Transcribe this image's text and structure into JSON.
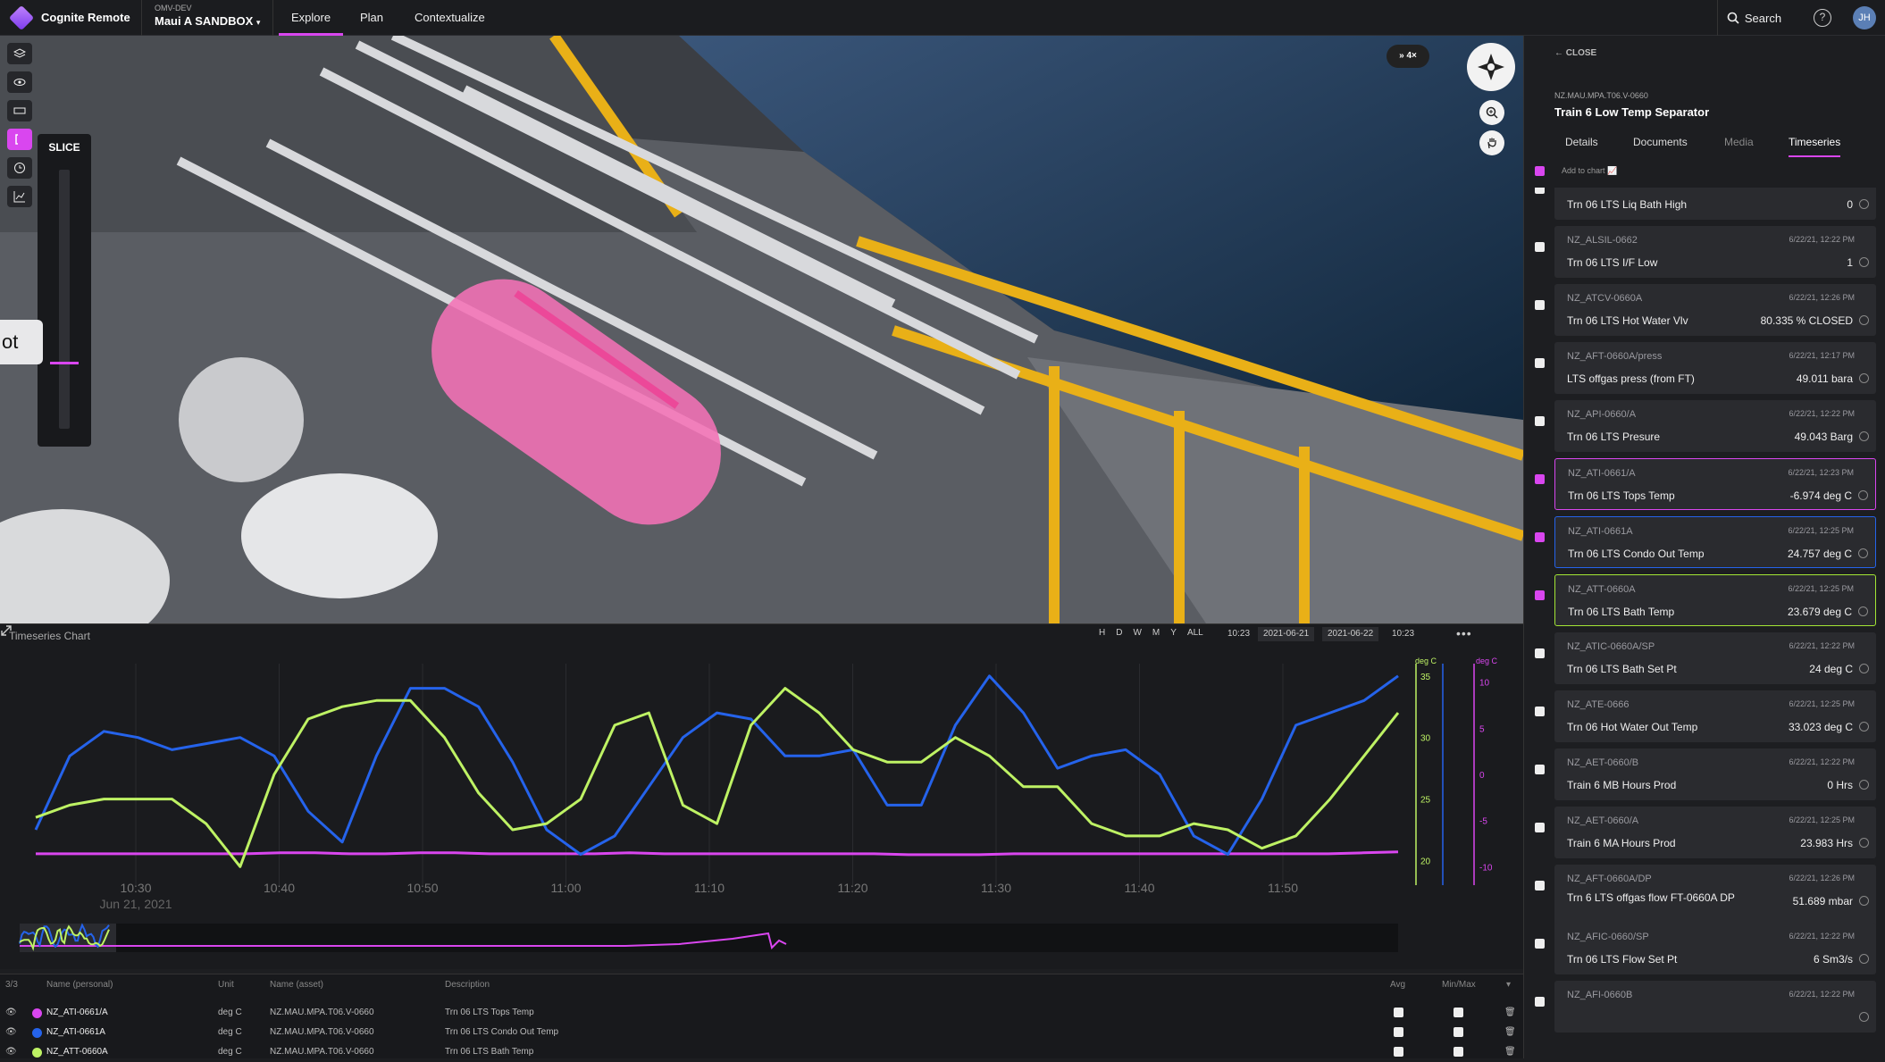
{
  "topbar": {
    "app_name": "Cognite Remote",
    "project_sub": "OMV-DEV",
    "project_name": "Maui A SANDBOX",
    "tabs": [
      "Explore",
      "Plan",
      "Contextualize"
    ],
    "search": "Search",
    "help": "?",
    "avatar": "JH"
  },
  "scene": {
    "slice_label": "SLICE",
    "overlay_text": "ot",
    "speed_label": "» 4×",
    "colors": {
      "highlight": "#f472b6",
      "accent": "#d946ef"
    }
  },
  "chart": {
    "title": "Timeseries Chart",
    "ranges": [
      "H",
      "D",
      "W",
      "M",
      "Y",
      "ALL"
    ],
    "from_time": "10:23",
    "from_date": "2021-06-21",
    "to_date": "2021-06-22",
    "to_time": "10:23",
    "more": "•••",
    "y_axes": [
      {
        "label": "deg C",
        "ticks": [
          "35",
          "30",
          "25",
          "20"
        ]
      },
      {
        "label": "deg C",
        "ticks": [
          "10",
          "5",
          "0",
          "-5",
          "-10"
        ]
      }
    ]
  },
  "chart_data": {
    "type": "line",
    "x_ticks": [
      "10:30",
      "10:40",
      "10:50",
      "11:00",
      "11:10",
      "11:20",
      "11:30",
      "11:40",
      "11:50"
    ],
    "x_date": "Jun 21, 2021",
    "series": [
      {
        "name": "NZ_ATI-0661/A",
        "color": "#d946ef",
        "axis": "right2",
        "values": [
          -8.6,
          -8.6,
          -8.6,
          -8.6,
          -8.6,
          -8.6,
          -8.6,
          -8.5,
          -8.5,
          -8.6,
          -8.6,
          -8.5,
          -8.5,
          -8.6,
          -8.6,
          -8.6,
          -8.6,
          -8.5,
          -8.6,
          -8.6,
          -8.6,
          -8.6,
          -8.6,
          -8.6,
          -8.6,
          -8.7,
          -8.7,
          -8.7,
          -8.6,
          -8.6,
          -8.6,
          -8.6,
          -8.6,
          -8.6,
          -8.6,
          -8.6,
          -8.6,
          -8.6,
          -8.5,
          -8.4
        ]
      },
      {
        "name": "NZ_ATI-0661A",
        "color": "#2563eb",
        "axis": "right1",
        "values": [
          22.5,
          28.5,
          30.5,
          30,
          29,
          29.5,
          30,
          28.5,
          24,
          21.5,
          28.5,
          34,
          34,
          32.5,
          28,
          22.5,
          20.5,
          22,
          26,
          30,
          32,
          31.5,
          28.5,
          28.5,
          29,
          24.5,
          24.5,
          31,
          35,
          32,
          27.5,
          28.5,
          29,
          27,
          22,
          20.5,
          25,
          31,
          32,
          33,
          35
        ]
      },
      {
        "name": "NZ_ATT-0660A",
        "color": "#bef264",
        "axis": "right1",
        "values": [
          23.5,
          24.5,
          25,
          25,
          25,
          23,
          19.5,
          27,
          31.5,
          32.5,
          33,
          33,
          30,
          25.5,
          22.5,
          23,
          25,
          31,
          32,
          24.5,
          23,
          31,
          34,
          32,
          29,
          28,
          28,
          30,
          28.5,
          26,
          26,
          23,
          22,
          22,
          23,
          22.5,
          21,
          22,
          25,
          28.5,
          32
        ]
      }
    ]
  },
  "legend": {
    "count": "3/3",
    "headers": [
      "Name (personal)",
      "Unit",
      "Name (asset)",
      "Description",
      "Avg",
      "Min/Max"
    ],
    "rows": [
      {
        "name": "NZ_ATI-0661/A",
        "unit": "deg C",
        "asset": "NZ.MAU.MPA.T06.V-0660",
        "desc": "Trn 06 LTS Tops Temp",
        "color": "#d946ef"
      },
      {
        "name": "NZ_ATI-0661A",
        "unit": "deg C",
        "asset": "NZ.MAU.MPA.T06.V-0660",
        "desc": "Trn 06 LTS Condo Out Temp",
        "color": "#2563eb"
      },
      {
        "name": "NZ_ATT-0660A",
        "unit": "deg C",
        "asset": "NZ.MAU.MPA.T06.V-0660",
        "desc": "Trn 06 LTS Bath Temp",
        "color": "#bef264"
      }
    ]
  },
  "panel": {
    "close": "CLOSE",
    "asset_tag": "NZ.MAU.MPA.T06.V-0660",
    "asset_name": "Train 6 Low Temp Separator",
    "tabs": [
      "Details",
      "Documents",
      "Media",
      "Timeseries"
    ],
    "add_to_chart": "Add to chart",
    "items": [
      {
        "code": "NZ_ALSHH-0663",
        "time": "",
        "name": "Trn 06 LTS Liq Bath High",
        "value": "0"
      },
      {
        "code": "NZ_ALSIL-0662",
        "time": "6/22/21, 12:22 PM",
        "name": "Trn 06 LTS I/F Low",
        "value": "1"
      },
      {
        "code": "NZ_ATCV-0660A",
        "time": "6/22/21, 12:26 PM",
        "name": "Trn 06 LTS Hot Water Vlv",
        "value": "80.335 % CLOSED"
      },
      {
        "code": "NZ_AFT-0660A/press",
        "time": "6/22/21, 12:17 PM",
        "name": "LTS offgas press (from FT)",
        "value": "49.011 bara"
      },
      {
        "code": "NZ_API-0660/A",
        "time": "6/22/21, 12:22 PM",
        "name": "Trn 06 LTS Presure",
        "value": "49.043 Barg"
      },
      {
        "code": "NZ_ATI-0661/A",
        "time": "6/22/21, 12:23 PM",
        "name": "Trn 06 LTS Tops Temp",
        "value": "-6.974 deg C"
      },
      {
        "code": "NZ_ATI-0661A",
        "time": "6/22/21, 12:25 PM",
        "name": "Trn 06 LTS Condo Out Temp",
        "value": "24.757 deg C"
      },
      {
        "code": "NZ_ATT-0660A",
        "time": "6/22/21, 12:25 PM",
        "name": "Trn 06 LTS Bath Temp",
        "value": "23.679 deg C"
      },
      {
        "code": "NZ_ATIC-0660A/SP",
        "time": "6/22/21, 12:22 PM",
        "name": "Trn 06 LTS Bath Set Pt",
        "value": "24 deg C"
      },
      {
        "code": "NZ_ATE-0666",
        "time": "6/22/21, 12:25 PM",
        "name": "Trn 06 Hot Water Out Temp",
        "value": "33.023 deg C"
      },
      {
        "code": "NZ_AET-0660/B",
        "time": "6/22/21, 12:22 PM",
        "name": "Train 6 MB Hours Prod",
        "value": "0 Hrs"
      },
      {
        "code": "NZ_AET-0660/A",
        "time": "6/22/21, 12:25 PM",
        "name": "Train 6 MA Hours Prod",
        "value": "23.983 Hrs"
      },
      {
        "code": "NZ_AFT-0660A/DP",
        "time": "6/22/21, 12:26 PM",
        "name": "Trn 6 LTS offgas flow FT-0660A DP",
        "value": "51.689 mbar"
      },
      {
        "code": "NZ_AFIC-0660/SP",
        "time": "6/22/21, 12:22 PM",
        "name": "Trn 06 LTS Flow Set Pt",
        "value": "6 Sm3/s"
      },
      {
        "code": "NZ_AFI-0660B",
        "time": "6/22/21, 12:22 PM",
        "name": "",
        "value": ""
      }
    ]
  }
}
